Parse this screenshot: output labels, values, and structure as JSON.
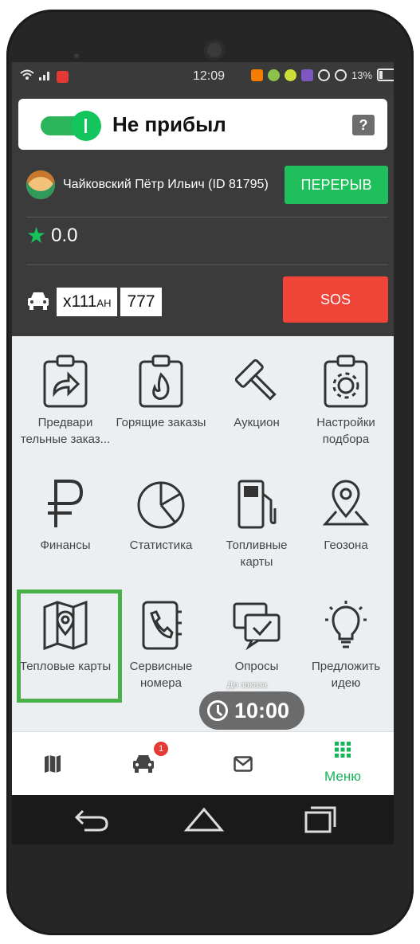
{
  "status_bar": {
    "time": "12:09",
    "battery": "13%"
  },
  "driver_status": {
    "label": "Не прибыл",
    "help": "?"
  },
  "driver": {
    "name": "Чайковский Пётр Ильич (ID 81795)",
    "break_button": "ПЕРЕРЫВ"
  },
  "rating": {
    "value": "0.0"
  },
  "car": {
    "plate_main": "х111",
    "plate_suffix": "ан",
    "region": "777",
    "sos_button": "SOS"
  },
  "menu_tiles": [
    {
      "label": "Предвари тельные заказ...",
      "icon": "clipboard-arrow-icon"
    },
    {
      "label": "Горящие заказы",
      "icon": "clipboard-fire-icon"
    },
    {
      "label": "Аукцион",
      "icon": "gavel-icon"
    },
    {
      "label": "Настройки подбора",
      "icon": "clipboard-gear-icon"
    },
    {
      "label": "Финансы",
      "icon": "ruble-icon"
    },
    {
      "label": "Статистика",
      "icon": "pie-chart-icon"
    },
    {
      "label": "Топливные карты",
      "icon": "fuel-pump-icon"
    },
    {
      "label": "Геозона",
      "icon": "map-pin-icon"
    },
    {
      "label": "Тепловые карты",
      "icon": "heat-map-icon"
    },
    {
      "label": "Сервисные номера",
      "icon": "phone-book-icon"
    },
    {
      "label": "Опросы",
      "icon": "survey-chat-icon"
    },
    {
      "label": "Предложить идею",
      "icon": "lightbulb-icon"
    }
  ],
  "timer": {
    "title": "До заказа",
    "value": "10:00"
  },
  "bottom_nav": {
    "badge_count": "1",
    "menu_label": "Меню"
  },
  "colors": {
    "accent_green": "#14c45c",
    "sos_red": "#f04438",
    "highlight": "#4ab04a"
  }
}
